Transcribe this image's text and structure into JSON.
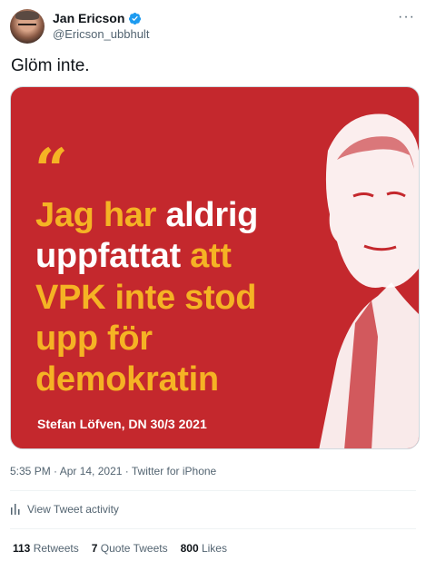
{
  "author": {
    "display_name": "Jan Ericson",
    "handle": "@Ericson_ubbhult",
    "more_icon": "more-horizontal-icon",
    "verified_icon": "verified-badge-icon"
  },
  "tweet": {
    "text": "Glöm inte.",
    "timestamp": "5:35 PM · Apr 14, 2021 · Twitter for iPhone"
  },
  "image": {
    "quote_mark": "“",
    "lines": [
      [
        {
          "text": "Jag har ",
          "color": "yellow"
        },
        {
          "text": "aldrig",
          "color": "white"
        }
      ],
      [
        {
          "text": "uppfattat ",
          "color": "white"
        },
        {
          "text": "att",
          "color": "yellow"
        }
      ],
      [
        {
          "text": "VPK inte stod",
          "color": "yellow"
        }
      ],
      [
        {
          "text": "upp för",
          "color": "yellow"
        }
      ],
      [
        {
          "text": "demokratin",
          "color": "yellow"
        }
      ]
    ],
    "attribution": "Stefan Löfven, DN 30/3 2021",
    "colors": {
      "background": "#c4282d",
      "yellow": "#f5b324",
      "white": "#ffffff"
    }
  },
  "activity": {
    "label": "View Tweet activity",
    "icon": "bar-chart-icon"
  },
  "stats": {
    "retweets_count": "113",
    "retweets_label": "Retweets",
    "quotes_count": "7",
    "quotes_label": "Quote Tweets",
    "likes_count": "800",
    "likes_label": "Likes"
  },
  "colors": {
    "text": "#0f1419",
    "secondary": "#536471",
    "verified": "#1d9bf0"
  }
}
